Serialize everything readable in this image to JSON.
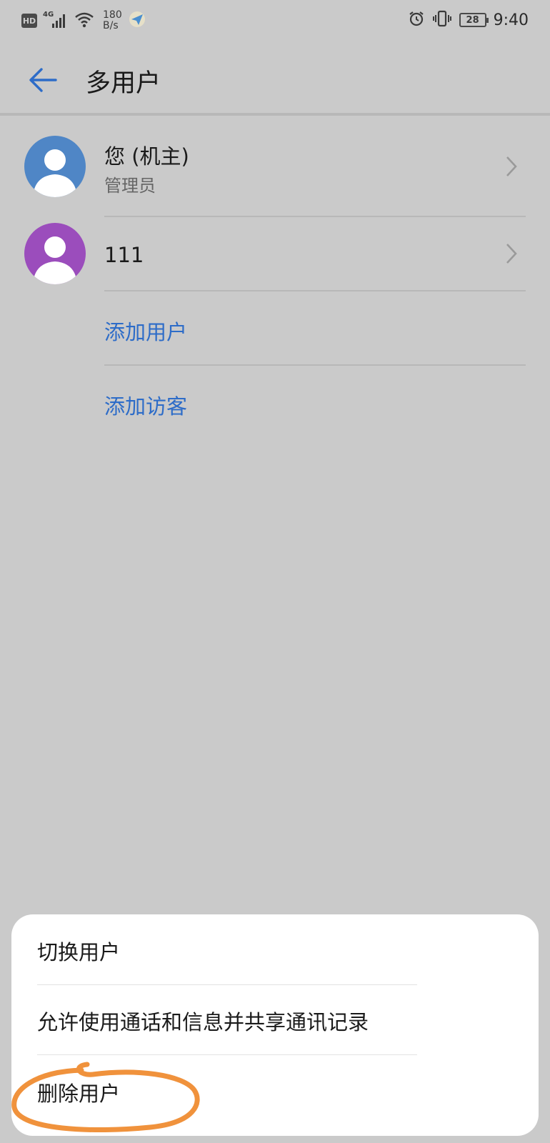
{
  "status_bar": {
    "hd": "HD",
    "network": "4G",
    "speed_value": "180",
    "speed_unit": "B/s",
    "battery": "28",
    "time": "9:40"
  },
  "header": {
    "title": "多用户"
  },
  "users": [
    {
      "name": "您 (机主)",
      "role": "管理员",
      "avatar_color": "#4f86c6"
    },
    {
      "name": "111",
      "avatar_color": "#9b4dbc"
    }
  ],
  "actions": {
    "add_user": "添加用户",
    "add_guest": "添加访客"
  },
  "sheet": {
    "items": [
      "切换用户",
      "允许使用通话和信息并共享通讯记录",
      "删除用户"
    ]
  },
  "colors": {
    "accent": "#2d6cc8",
    "highlight": "#f0923c"
  }
}
